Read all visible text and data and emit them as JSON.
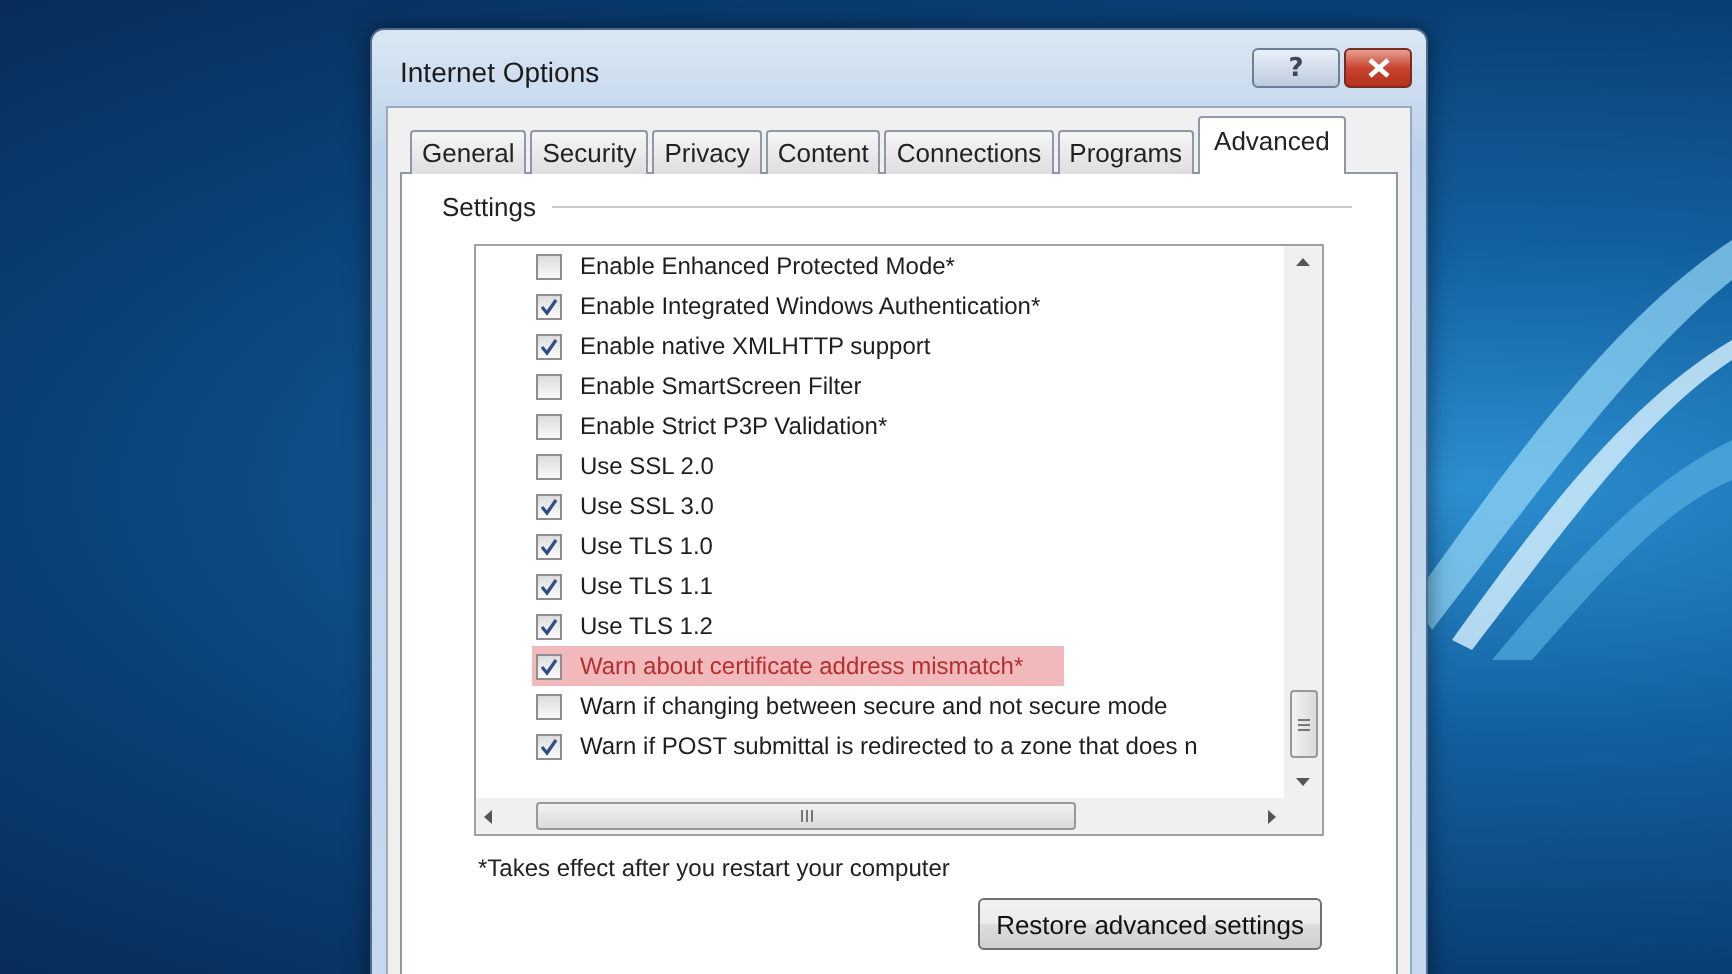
{
  "window": {
    "title": "Internet Options",
    "help_label": "?"
  },
  "tabs": [
    {
      "label": "General",
      "selected": false
    },
    {
      "label": "Security",
      "selected": false
    },
    {
      "label": "Privacy",
      "selected": false
    },
    {
      "label": "Content",
      "selected": false
    },
    {
      "label": "Connections",
      "selected": false
    },
    {
      "label": "Programs",
      "selected": false
    },
    {
      "label": "Advanced",
      "selected": true
    }
  ],
  "settings_group": {
    "label": "Settings"
  },
  "settings": [
    {
      "label": "Enable Enhanced Protected Mode*",
      "checked": false,
      "highlighted": false
    },
    {
      "label": "Enable Integrated Windows Authentication*",
      "checked": true,
      "highlighted": false
    },
    {
      "label": "Enable native XMLHTTP support",
      "checked": true,
      "highlighted": false
    },
    {
      "label": "Enable SmartScreen Filter",
      "checked": false,
      "highlighted": false
    },
    {
      "label": "Enable Strict P3P Validation*",
      "checked": false,
      "highlighted": false
    },
    {
      "label": "Use SSL 2.0",
      "checked": false,
      "highlighted": false
    },
    {
      "label": "Use SSL 3.0",
      "checked": true,
      "highlighted": false
    },
    {
      "label": "Use TLS 1.0",
      "checked": true,
      "highlighted": false
    },
    {
      "label": "Use TLS 1.1",
      "checked": true,
      "highlighted": false
    },
    {
      "label": "Use TLS 1.2",
      "checked": true,
      "highlighted": false
    },
    {
      "label": "Warn about certificate address mismatch*",
      "checked": true,
      "highlighted": true
    },
    {
      "label": "Warn if changing between secure and not secure mode",
      "checked": false,
      "highlighted": false
    },
    {
      "label": "Warn if POST submittal is redirected to a zone that does n",
      "checked": true,
      "highlighted": false
    }
  ],
  "footnote": "*Takes effect after you restart your computer",
  "buttons": [
    {
      "label": "Restore advanced settings"
    }
  ]
}
